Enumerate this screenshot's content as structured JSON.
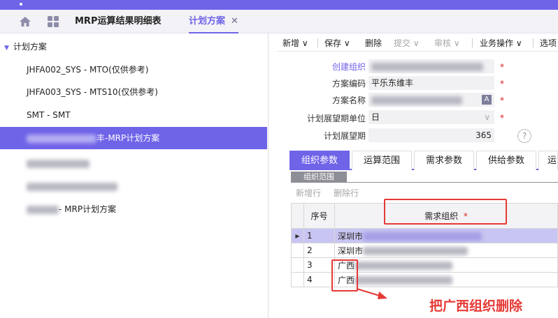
{
  "tabbar": {
    "tabs": [
      {
        "label": "MRP运算结果明细表"
      },
      {
        "label": "计划方案",
        "close": "✕"
      }
    ]
  },
  "tree": {
    "root": "计划方案",
    "items": [
      {
        "label": "JHFA002_SYS - MTO(仅供参考)"
      },
      {
        "label": "JHFA003_SYS - MTS10(仅供参考)"
      },
      {
        "label": "SMT - SMT"
      },
      {
        "label": "丰-MRP计划方案"
      },
      {
        "label": ""
      },
      {
        "label": ""
      },
      {
        "label": "- MRP计划方案"
      }
    ]
  },
  "toolbar": {
    "items": [
      {
        "label": "新增 ∨"
      },
      {
        "label": "保存 ∨"
      },
      {
        "label": "删除"
      },
      {
        "label": "提交 ∨"
      },
      {
        "label": "审核 ∨"
      },
      {
        "label": "业务操作 ∨"
      },
      {
        "label": "选项"
      }
    ]
  },
  "form": {
    "create_org_label": "创建组织",
    "code_label": "方案编码",
    "code_value": "平乐东维丰",
    "name_label": "方案名称",
    "unit_label": "计划展望期单位",
    "unit_value": "日",
    "period_label": "计划展望期",
    "period_value": "365",
    "required_mark": "*",
    "help_glyph": "?",
    "lang_glyph": "A"
  },
  "subtabs": [
    {
      "label": "组织参数"
    },
    {
      "label": "运算范围"
    },
    {
      "label": "需求参数"
    },
    {
      "label": "供给参数"
    },
    {
      "label": "运"
    }
  ],
  "section": {
    "tab": "组织范围",
    "add_row": "新增行",
    "delete_row": "删除行"
  },
  "grid": {
    "col_seq": "序号",
    "col_org": "需求组织",
    "required_mark": "*",
    "rows": [
      {
        "seq": "1",
        "org": "深圳市"
      },
      {
        "seq": "2",
        "org": "深圳市"
      },
      {
        "seq": "3",
        "org": "广西"
      },
      {
        "seq": "4",
        "org": "广西"
      }
    ]
  },
  "annotation": "把广西组织删除",
  "colors": {
    "accent": "#6f63e8",
    "annotation": "#e53935"
  }
}
